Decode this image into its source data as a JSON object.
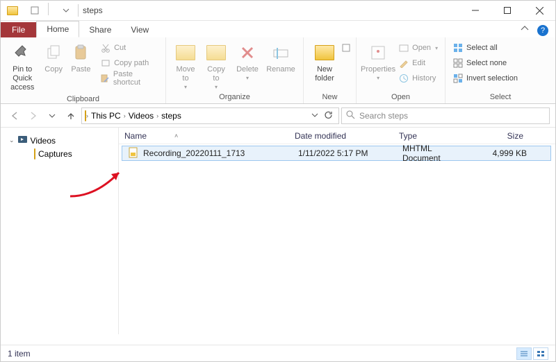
{
  "window": {
    "title": "steps"
  },
  "tabs": {
    "file": "File",
    "home": "Home",
    "share": "Share",
    "view": "View"
  },
  "ribbon": {
    "clipboard": {
      "label": "Clipboard",
      "pin": "Pin to Quick\naccess",
      "copy": "Copy",
      "paste": "Paste",
      "cut": "Cut",
      "copy_path": "Copy path",
      "paste_shortcut": "Paste shortcut"
    },
    "organize": {
      "label": "Organize",
      "move_to": "Move\nto",
      "copy_to": "Copy\nto",
      "delete": "Delete",
      "rename": "Rename"
    },
    "new": {
      "label": "New",
      "new_folder": "New\nfolder"
    },
    "open": {
      "label": "Open",
      "properties": "Properties",
      "open": "Open",
      "edit": "Edit",
      "history": "History"
    },
    "select": {
      "label": "Select",
      "select_all": "Select all",
      "select_none": "Select none",
      "invert": "Invert selection"
    }
  },
  "breadcrumb": {
    "seg1": "This PC",
    "seg2": "Videos",
    "seg3": "steps"
  },
  "search": {
    "placeholder": "Search steps"
  },
  "tree": {
    "videos": "Videos",
    "captures": "Captures"
  },
  "columns": {
    "name": "Name",
    "date": "Date modified",
    "type": "Type",
    "size": "Size"
  },
  "files": [
    {
      "name": "Recording_20220111_1713",
      "date": "1/11/2022 5:17 PM",
      "type": "MHTML Document",
      "size": "4,999 KB"
    }
  ],
  "status": {
    "count": "1 item"
  }
}
